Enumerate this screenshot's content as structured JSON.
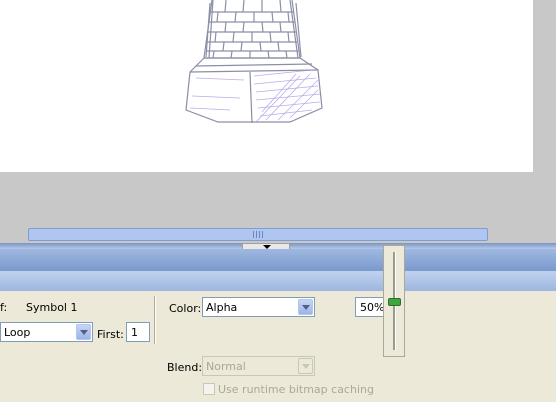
{
  "properties": {
    "instance_prefix": "f:",
    "instance_name": "Symbol 1",
    "loop_select": "Loop",
    "first_label": "First:",
    "first_value": "1",
    "color_label": "Color:",
    "color_select": "Alpha",
    "alpha_value": "50%",
    "blend_label": "Blend:",
    "blend_select": "Normal",
    "cache_label": "Use runtime bitmap caching",
    "alpha_slider_level": 0.5
  },
  "icons": {
    "collapse": "triangle-down-icon",
    "scroll_grip": "grip-icon"
  },
  "colors": {
    "panel_header": "#7b99cf",
    "scroll_track": "#aec6f0",
    "slider_thumb": "#3fa53f"
  }
}
